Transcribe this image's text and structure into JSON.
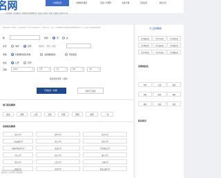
{
  "header": {
    "logo_text": "名网",
    "nav": [
      {
        "label": "AI智能起名"
      },
      {
        "label": "免费姓名测试"
      },
      {
        "label": "生辰八字测算"
      },
      {
        "label": "起名字典"
      },
      {
        "label": "宝宝起名"
      },
      {
        "label": "姓名大全"
      }
    ]
  },
  "subnav": "…, 宝宝起名, 宝宝取名字, 取名网, 起名网打分, 生辰八字起名, 生辰八字取名, 起名字大全",
  "main": {
    "intro": "周易生辰八字起名，宝宝起名名字大全，结合姓名学、周易八卦、五行、诗词典故等传统起名文化精选好名字，让您的宝宝赢在起跑线",
    "form": {
      "surname_label": "姓",
      "gender_label": "性别",
      "gender_options": [
        "男",
        "女"
      ],
      "name_type_label": "名字",
      "name_type_options": [
        "单字",
        "双字"
      ],
      "birth_label": "出生",
      "birth_options": [
        "公历",
        "农历"
      ],
      "character_label": "特殊字：首字 / 尾字",
      "character_placeholder": "",
      "style_label": "风格",
      "style_options": [
        "智能推荐起名风格",
        "诗经楚辞起名",
        "周易起名"
      ],
      "date_label": "日期",
      "year": "2024",
      "month": "1月",
      "day": "1日",
      "hour": "0时",
      "minute": "0分",
      "generate_label": "开始起名（免费）",
      "expert_label": "专家手工起名",
      "more_title": "更多起名类型（选填）"
    },
    "popular_title": "热门起名解读",
    "popular_names": [
      "俊凯",
      "晓明",
      "子轩",
      "浩然",
      "梓萱",
      "雨桐",
      "欣怡",
      "一诺"
    ],
    "schools_title": "名校起名解读",
    "schools": [
      [
        "北京大学",
        "清华大学",
        "复旦大学"
      ],
      [
        "上海交通大学",
        "浙江大学",
        "南京大学"
      ],
      [
        "中国科学技术大学",
        "武汉大学",
        "华中科技大学"
      ],
      [
        "中山大学",
        "四川大学",
        "厦门大学"
      ],
      [
        "南开大学",
        "山东大学",
        "吉林大学"
      ],
      [
        "同济大学",
        "天津大学",
        "西安交通大学"
      ]
    ],
    "footer_lines": [
      "Copyright © 起名网 版权所有",
      "联系我们 | 免责声明 | 网站地图"
    ]
  },
  "sidebar": {
    "wuxing_title": "十二生肖起名",
    "wuxing_items": [
      "生肖鼠起名",
      "生肖牛起名",
      "生肖虎起名",
      "生肖兔起名",
      "生肖龙起名",
      "生肖蛇起名",
      "生肖马起名",
      "生肖羊起名",
      "生肖猴起名"
    ],
    "surname_title": "百家姓起名",
    "surname_items": [
      "李姓",
      "王姓",
      "张姓",
      "刘姓",
      "陈姓",
      "杨姓",
      "黄姓",
      "赵姓",
      "吴姓"
    ],
    "news_title": "起名知识"
  }
}
